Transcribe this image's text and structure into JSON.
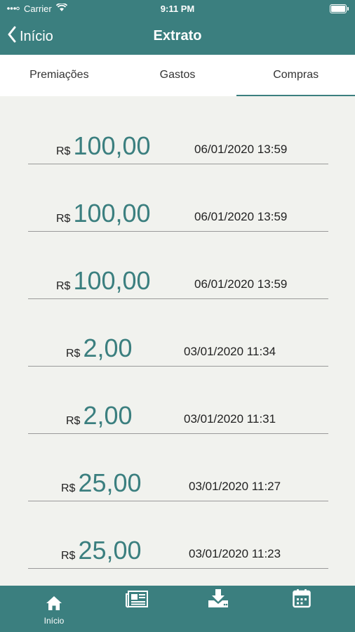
{
  "status_bar": {
    "carrier": "Carrier",
    "time": "9:11 PM"
  },
  "nav": {
    "back_label": "Início",
    "title": "Extrato"
  },
  "tabs": [
    {
      "label": "Premiações",
      "active": false
    },
    {
      "label": "Gastos",
      "active": false
    },
    {
      "label": "Compras",
      "active": true
    }
  ],
  "entries": [
    {
      "currency": "R$",
      "amount": "100,00",
      "datetime": "06/01/2020 13:59"
    },
    {
      "currency": "R$",
      "amount": "100,00",
      "datetime": "06/01/2020 13:59"
    },
    {
      "currency": "R$",
      "amount": "100,00",
      "datetime": "06/01/2020 13:59"
    },
    {
      "currency": "R$",
      "amount": "2,00",
      "datetime": "03/01/2020 11:34"
    },
    {
      "currency": "R$",
      "amount": "2,00",
      "datetime": "03/01/2020 11:31"
    },
    {
      "currency": "R$",
      "amount": "25,00",
      "datetime": "03/01/2020 11:27"
    },
    {
      "currency": "R$",
      "amount": "25,00",
      "datetime": "03/01/2020 11:23"
    }
  ],
  "tabbar": {
    "home_label": "Início"
  },
  "colors": {
    "primary": "#3b7f7f",
    "background": "#f1f2ee"
  }
}
